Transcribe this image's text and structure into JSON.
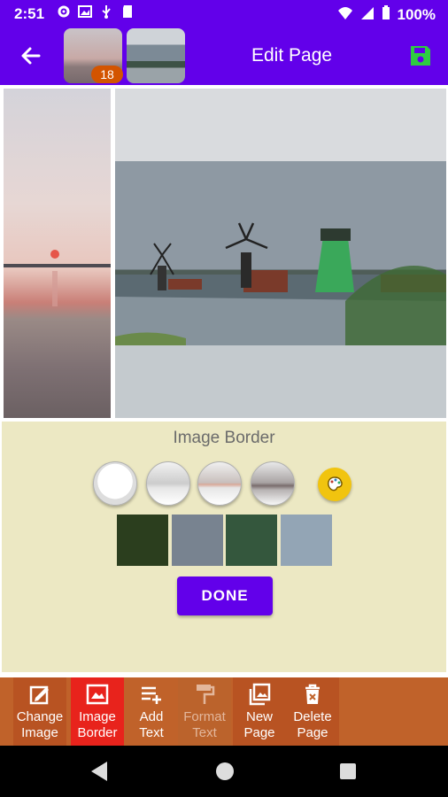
{
  "status_bar": {
    "time": "2:51",
    "battery": "100%"
  },
  "app_bar": {
    "title": "Edit Page",
    "page_badge": "18"
  },
  "panel": {
    "title": "Image Border",
    "swatch_colors": [
      "#2b3e1e",
      "#788390",
      "#34573d",
      "#93a5b5"
    ],
    "done_label": "DONE"
  },
  "toolbar": {
    "items": [
      {
        "label": "Change\nImage",
        "icon": "edit-image-icon",
        "active": false,
        "enabled": true
      },
      {
        "label": "Image\nBorder",
        "icon": "image-border-icon",
        "active": true,
        "enabled": true
      },
      {
        "label": "Add\nText",
        "icon": "add-text-icon",
        "active": false,
        "enabled": true
      },
      {
        "label": "Format\nText",
        "icon": "paint-roller-icon",
        "active": false,
        "enabled": false
      },
      {
        "label": "New\nPage",
        "icon": "new-page-icon",
        "active": false,
        "enabled": true
      },
      {
        "label": "Delete\nPage",
        "icon": "trash-icon",
        "active": false,
        "enabled": true
      }
    ]
  },
  "colors": {
    "primary": "#6200ea",
    "toolbar_bg": "#c0622a",
    "active_tool": "#e8231c",
    "panel_bg": "#ece8c3",
    "save_icon": "#2ecc40"
  }
}
